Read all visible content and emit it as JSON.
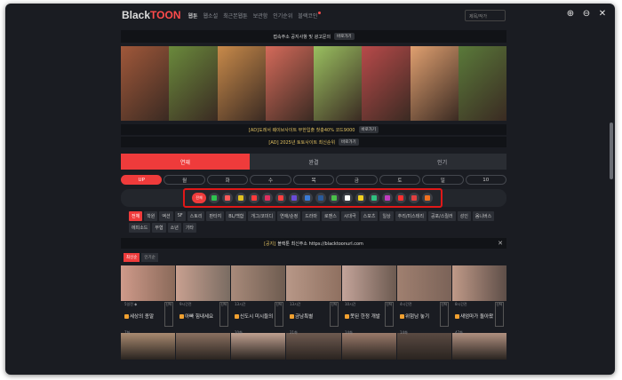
{
  "viewer_icons": [
    "zoom-in-icon",
    "zoom-out-icon",
    "close-icon"
  ],
  "viewer_glyphs": [
    "⊕",
    "⊖",
    "✕"
  ],
  "header": {
    "logo_a": "Black",
    "logo_b": "TOON",
    "menu": [
      "웹툰",
      "웹소설",
      "최근본웹툰",
      "보관함",
      "인기순위",
      "블랙코인"
    ],
    "search_placeholder": "제목/작가"
  },
  "notice_top": {
    "text": "접속주소 공지사항 및 광고문의",
    "button": "바로가기"
  },
  "ads": [
    {
      "text": "[AD]도레서 웨이브사이트 무한입출 첫충40% 코드9000",
      "button": "바로가기"
    },
    {
      "text": "[AD] 2025년 토토사이트 최신순위",
      "button": "바로가기"
    }
  ],
  "day_tabs": [
    "연재",
    "완결",
    "인기"
  ],
  "weekdays": [
    "UP",
    "월",
    "화",
    "수",
    "목",
    "금",
    "토",
    "일",
    "10"
  ],
  "platform_all": "전체",
  "platforms": [
    "#2ec44f",
    "#ff5a5a",
    "#e0c020",
    "#ff3b3b",
    "#e03060",
    "#ff4040",
    "#6a4bd8",
    "#3a7bd5",
    "#2a5a9a",
    "#4ac04a",
    "#ffffff",
    "#f0d020",
    "#30c080",
    "#c03cc0",
    "#ff3030",
    "#e04040",
    "#f07020"
  ],
  "genres": [
    "전체",
    "학원",
    "액션",
    "SF",
    "스토리",
    "판타지",
    "BL/백합",
    "개그/코미디",
    "연애/순정",
    "드라마",
    "로맨스",
    "시대극",
    "스포츠",
    "일상",
    "추리/미스테리",
    "공포/스릴러",
    "성인",
    "옴니버스",
    "에피소드",
    "무협",
    "소년",
    "기타"
  ],
  "notice2": {
    "tag": "[공지]",
    "text": "블랙툰 최신주소 https://blacktoonurl.com",
    "close": "✕"
  },
  "subtabs": [
    "최신순",
    "인기순"
  ],
  "thumb_colors": [
    "#cf9a8a",
    "#8a6a5a",
    "#c8a090",
    "#7a6c62",
    "#a88a7a",
    "#6e5c50",
    "#b89888",
    "#8f7060",
    "#c4a49a",
    "#6c5a50",
    "#a08070",
    "#7b6358",
    "#c09a88",
    "#5e4e48"
  ],
  "thumb2_colors": [
    "#a98a70",
    "#8a7060",
    "#c0a090",
    "#6e5a50",
    "#9a7a6a",
    "#5a4a42",
    "#b09080"
  ],
  "banner_colors": [
    "#a0583a",
    "#6a8a3c",
    "#c88a4a",
    "#d46a5a",
    "#9ac060",
    "#b84a4a",
    "#e0a070",
    "#5a7a3a"
  ],
  "comics": [
    {
      "title": "세상의 종말",
      "sub": "7화",
      "meta": "5일전 ◆",
      "badge": "신작"
    },
    {
      "title": "아빠 힘내세요",
      "sub": "",
      "meta": "9시간전",
      "badge": "신작"
    },
    {
      "title": "신도시 미시들의",
      "sub": "20화",
      "meta": "13시간",
      "badge": "신작"
    },
    {
      "title": "금남특별",
      "sub": "21화",
      "meta": "13시간",
      "badge": "신작"
    },
    {
      "title": "못된 한정 개발",
      "sub": "14화",
      "meta": "10시간",
      "badge": "신작"
    },
    {
      "title": "위험남 놓기",
      "sub": "14화",
      "meta": "4시간전",
      "badge": "신작"
    },
    {
      "title": "새엄마가 돌아왔",
      "sub": "47화",
      "meta": "8시간전",
      "badge": "신작"
    }
  ]
}
